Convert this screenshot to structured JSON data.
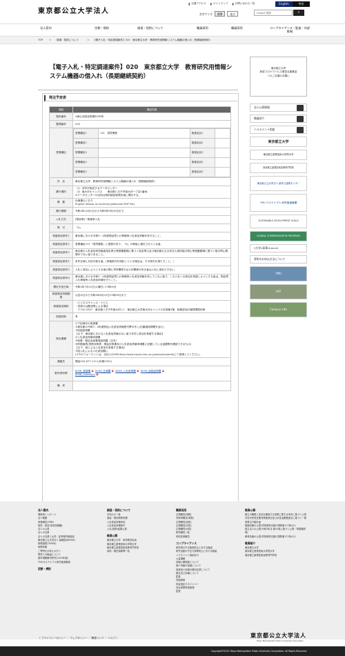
{
  "header": {
    "logo": "東京都公立大学法人",
    "util": [
      "交通アクセス",
      "サイトマップ",
      "お問い合わせ一覧"
    ],
    "lang": [
      "English",
      "中文"
    ],
    "font_size_label": "文字サイズ",
    "font_std": "標準",
    "font_large": "拡大",
    "search_placeholder": "Google 提供",
    "search_icon": "search-icon"
  },
  "nav": [
    "法人案内",
    "空都・規則",
    "調達・契約について",
    "職員採用",
    "職員採用",
    "コンプライアンス・監査・内部統制"
  ],
  "breadcrumb": [
    "TOP",
    "＞",
    "調達・契約について",
    "＞",
    "【電子入札・特定調達案件】020　東京都立大学　教育研究用情報システム機器の借入れ（長期継続契約）"
  ],
  "page": {
    "title": "【電子入札・特定調達案件】020　東京都立大学　教育研究用情報システム機器の借入れ（長期継続契約）",
    "section": "発注予定表",
    "table_head": [
      "項目",
      "項目内容"
    ],
    "rows": [
      {
        "k": "契約番号",
        "v": "4東公法総会契第8038号"
      },
      {
        "k": "整理番号",
        "v": "020"
      }
    ],
    "type_label": "営業種目",
    "type_rows": [
      [
        "営業種目1",
        "131　賃貸業務",
        "取扱品目1",
        ""
      ],
      [
        "営業種目2",
        "",
        "取扱品目2",
        ""
      ],
      [
        "営業種目3",
        "",
        "取扱品目3",
        ""
      ],
      [
        "営業種目4",
        "",
        "取扱品目4",
        ""
      ],
      [
        "営業種目5",
        "",
        "取扱品目5",
        ""
      ]
    ],
    "rows2": [
      {
        "k": "件　名",
        "v": "東京都立大学　教育研究用情報システム機器の借入れ（長期継続契約）"
      },
      {
        "k": "履行場所",
        "v": "（1）本学が指定するデータセンター\n（2）南大沢キャンパス　　東京都八王子市南大沢一丁目1番地\n※データセンターの住所は契約締結後受託者に開示する。"
      },
      {
        "k": "概　要",
        "v": "仕様書のとおり\nEnglish follows as Summary(Attached PDF file)"
      },
      {
        "k": "履行期間",
        "v": "令和4年10月1日から令和9年9月30日まで"
      },
      {
        "k": "入札方式",
        "v": "[物品等]一般競争入札"
      },
      {
        "k": "等　付",
        "v": "「A」"
      },
      {
        "k": "希望参加条件1",
        "v": "東京都における令和3・4年度物品買入れ等競争入札参加資格を有すること。"
      },
      {
        "k": "希望参加条件2",
        "v": "営業種目131「賃貸業務」に登録があり、「A」の等級に格付されている者。"
      },
      {
        "k": "希望参加条件3",
        "v": "東京都の入札参加有資格者指名停止等措置要綱に基づく指名停止及び東京都公立大学法人契約取引停止等措置要綱に基づく取引停止期間中でない者であること。"
      },
      {
        "k": "希望参加条件4",
        "v": "本件仕様に対応可能な者。(資格条件を明記している場合は、その条件を満たすこと。)"
      },
      {
        "k": "希望参加条件5",
        "v": "入札に参加しようとする者の間に資本関係又は人的関係がある者は入札に参加できない。"
      },
      {
        "k": "希望参加条件6",
        "v": "東京都における令和3・4年度物品買入れ等競争入札参加資格を有していない者で、この入札への参加を希望しようとする者は、物品買入れ等競争入札参加申請を行うこと。"
      },
      {
        "k": "開札予定日時",
        "v": "令和4年7月12日(火曜日) 17時00分"
      },
      {
        "k": "希望参加申請期限",
        "v": "公告の日から令和4年6月10日17時00分まで"
      },
      {
        "k": "希望参加場所",
        "v": "・ビジネスチャンス・ナビ上\n・持参又は郵送等による場合\n　〒192-0397　東京都八王子市南大沢1-1　東京都立大学南大沢キャンパス本部棟1階　総務部会計管理課契約係"
      },
      {
        "k": "担保有無",
        "v": "有"
      },
      {
        "k": "提出書類",
        "v": "①下記様式の希望書\n②東京都の令和3・4年度物品入札参加資格受付票の写し(旧審査時期間を含む)\n③技能証明書\n【以下、東京都における入札参加資格のない者で本件に参加を希望する場合】\n④入札参加資格申請書\n⑤商業・登記全部事項証明書（正本）\n⑥財務諸表(貸借対照表・損益計算書及び入札参加資格申請書に記載している金額等を確認できるもの)\n【以下、総による入札参加を希望する場合】\n⑦総入札による入札参加願い\n(②⑦のフォーマットは、当法人のHP(https://www.houjin-tmu.ac.jp/keiyaku/seido)にて取得してください。"
      },
      {
        "k": "連絡先",
        "v": "電話042-677-1111(内線1052)"
      }
    ],
    "docs_label": "配布資料等",
    "docs": [
      "8038_希望書",
      "8038_仕様書",
      "8038_入札説明書",
      "8038_技能証明書",
      "8038_Summary"
    ],
    "remark_label": "備　考"
  },
  "side": {
    "box_lines": [
      "東京都立大学",
      "新型コロナウイルス緊急支援基金",
      "へのご支援のお願い"
    ],
    "links": [
      "法人公表情報",
      "教員紹介",
      "ハラスメント相談"
    ],
    "banners": [
      "東京都立大学",
      "東京都立産業技術大学院大学",
      "東京都立産業技術高等専門学校",
      "東京都公立大学法人 産学公連携センター",
      "TMU サステナブル 研究推進機構",
      "SUSTAINABLE DEVELOPMENT GOALS",
      "GLOBAL COMMUNICATION PROGRAM"
    ],
    "links2": [
      "2大学1高専channel",
      "寄附のお申込方法について"
    ],
    "photos": [
      "TMU",
      "AIIT",
      "Campus Life"
    ]
  },
  "footer": {
    "c1_title": "法人案内",
    "c1": [
      "理事長メッセージ",
      "法人概要",
      "事業報告(5MB)",
      "役員・役員(非役員報酬)",
      "法人の公表",
      "法人の沿革",
      "法人の沿革と大学・高専等所管施設",
      "東京都公立大学法人 組織図(683KB)",
      "財務諸表(395KB)",
      "財務情報",
      "ご寄附をお考えの方へ",
      "環境への取組について",
      "都市課題解決研究(2020年度)",
      "TMUサステナブル研究推進機構"
    ],
    "c1b_title": "定款・規則",
    "c2_title": "調達・契約について",
    "c2": [
      "お知らせ一覧",
      "調達・契約関係例規",
      "入札参加資格申請",
      "入札参加資格受付",
      "入札(見積)結果公表"
    ],
    "c2b_title": "教員公募",
    "c2b": [
      "東京都立大学　事任教員採用",
      "東京都立産業技術大学院大学",
      "東京都立産業技術高等専門学校",
      "採用・委任講師等一覧"
    ],
    "c3_title": "職員採用",
    "c3": [
      "正規職員[事務]",
      "非常勤職員[事務]",
      "正規職員[技術]",
      "正規職員[司書]",
      "正規職員[司書]",
      "研究職員 / 他",
      "特別任用職員"
    ],
    "c3b_title": "コンプライアンス",
    "c3b": [
      "研究費の不正使用防止に対する取組",
      "研究活動の不正行為等防止に対する取組",
      "ハラスメント相談窓口",
      "公益通報",
      "情報公開制度について",
      "個人情報の保護について",
      "保有個人情報の開示請求について",
      "匿名加工情報について",
      "監査",
      "内部統制",
      "利益相反マネジメント",
      "安全保障貿易管理",
      "監査"
    ],
    "c4_title": "教員公募",
    "c4": [
      "都立の職業と安全を確保する事業に関する本件に基づく公表",
      "次世代育成支援対策推進法及び女性活躍推進法に基づく一般事業主行動計画",
      "数値情報の公表(学校教育法施行規則第172条の2)",
      "独立法人の公表(令和3年法 第34条に基づく公表・附属機関等)",
      "教育情報の公表(学校教育法施行規則第172条の2)"
    ],
    "c4b_title": "教員紹介",
    "c4b": [
      "東京都立大学",
      "東京都立産業技術大学院大学",
      "東京都立産業技術高等専門学校"
    ],
    "links": "［ プライバシーポリシー ｜ ウェブポリシー ｜ 関連リンク ｜ ヘルプ ］",
    "logo": "東京都公立大学法人",
    "logo_en": "Tokyo Metropolitan Public University Corporation",
    "copyright": "Copyright©2022 Tokyo Metropolitan Public University Corporation. All Rights Reserved."
  }
}
